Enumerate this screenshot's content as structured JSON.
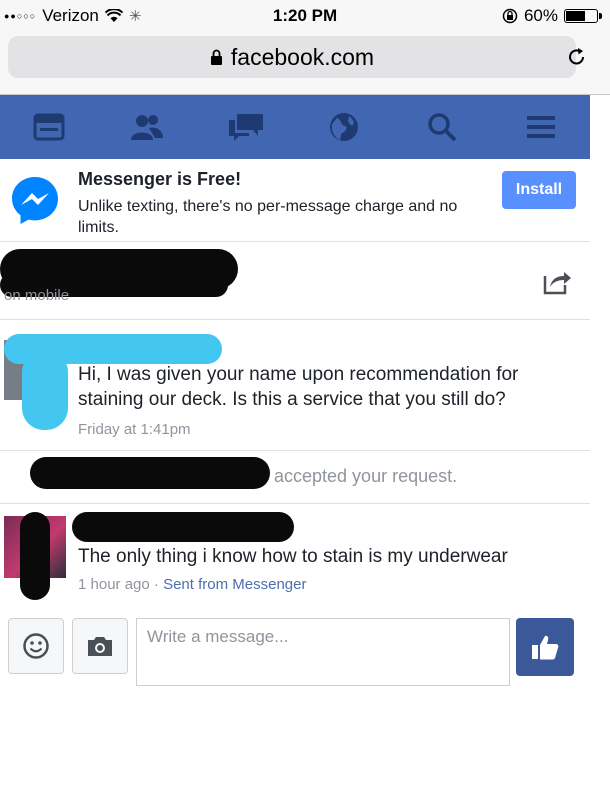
{
  "status_bar": {
    "carrier": "Verizon",
    "time": "1:20 PM",
    "battery": "60%",
    "signal_bars": 2,
    "battery_level": 0.6
  },
  "browser": {
    "url": "facebook.com",
    "lock_icon": "lock-icon",
    "reload_icon": "reload-icon"
  },
  "nav": {
    "icons": [
      "news-feed-icon",
      "friends-icon",
      "messages-icon",
      "globe-icon",
      "search-icon",
      "menu-icon"
    ],
    "background": "#4267b2"
  },
  "promo": {
    "title": "Messenger is Free!",
    "body": "Unlike texting, there's no per-message charge and no limits.",
    "button": "Install",
    "button_color": "#5890ff"
  },
  "thread": {
    "header_status": "on mobile",
    "first_message": {
      "text": "Hi, I was given your name upon recommendation for staining our deck. Is this a service that you still do?",
      "time": "Friday at 1:41pm"
    },
    "system_notice": "accepted your request.",
    "reply": {
      "text": "The only thing i know how to stain is my underwear",
      "time": "1 hour ago",
      "separator": " · ",
      "via": "Sent from Messenger"
    }
  },
  "composer": {
    "placeholder": "Write a message...",
    "emoji_icon": "smiley-icon",
    "camera_icon": "camera-icon",
    "like_icon": "thumbs-up-icon",
    "like_color": "#3b5998"
  }
}
